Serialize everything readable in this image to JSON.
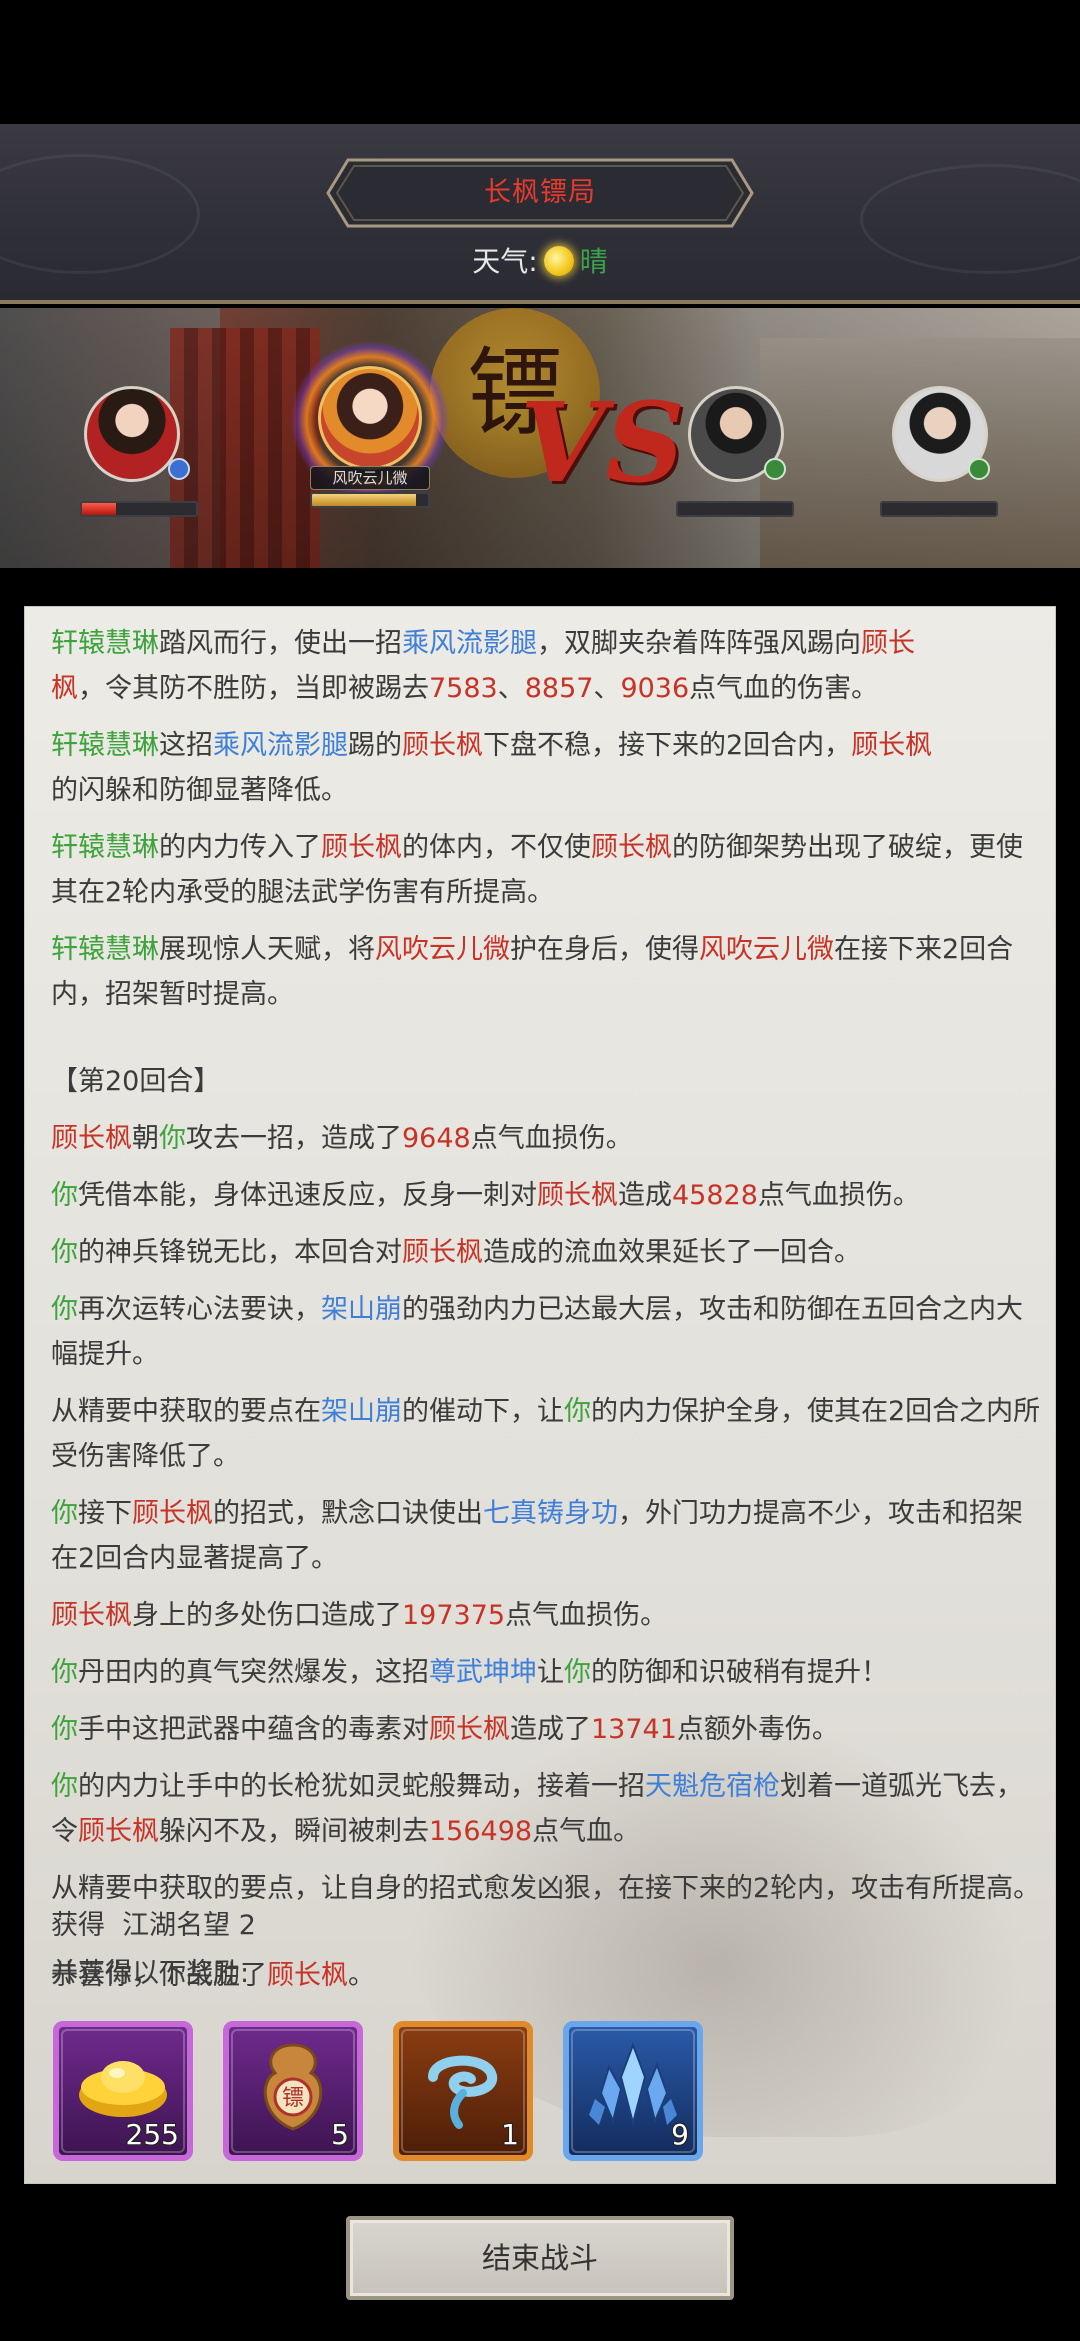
{
  "header": {
    "title": "长枫镖局",
    "weather_label": "天气:",
    "weather_value": "晴"
  },
  "battle": {
    "emblem_char": "镖",
    "vs_text": "VS",
    "allies": [
      {
        "name": "",
        "hp_fraction": 0.3
      },
      {
        "name": "风吹云儿微",
        "hp_fraction": 0.9
      }
    ],
    "enemies": [
      {
        "hp_fraction": 0.0
      },
      {
        "hp_fraction": 0.0
      }
    ]
  },
  "log": {
    "l1": {
      "a": "轩辕慧琳",
      "b": "踏风而行，使出一招",
      "c": "乘风流影腿",
      "d": "，双脚夹杂着阵阵强风踢向",
      "e": "顾长",
      "f": "枫",
      "g": "，令其防不胜防，当即被踢去",
      "h": "7583",
      "i": "、",
      "j": "8857",
      "k": "、",
      "l": "9036",
      "m": "点气血的伤害。"
    },
    "l2": {
      "a": "轩辕慧琳",
      "b": "这招",
      "c": "乘风流影腿",
      "d": "踢的",
      "e": "顾长枫",
      "f": "下盘不稳，接下来的2回合内，",
      "g": "顾长枫",
      "h": "的闪躲和防御显著降低。"
    },
    "l3": {
      "a": "轩辕慧琳",
      "b": "的内力传入了",
      "c": "顾长枫",
      "d": "的体内，不仅使",
      "e": "顾长枫",
      "f": "的防御架势出现了破绽，更使其在2轮内承受的腿法武学伤害有所提高。"
    },
    "l4": {
      "a": "轩辕慧琳",
      "b": "展现惊人天赋，将",
      "c": "风吹云儿微",
      "d": "护在身后，使得",
      "e": "风吹云儿微",
      "f": "在接下来2回合内，招架暂时提高。"
    },
    "round": "【第20回合】",
    "r1": {
      "a": "顾长枫",
      "b": "朝",
      "c": "你",
      "d": "攻去一招，造成了",
      "e": "9648",
      "f": "点气血损伤。"
    },
    "r2": {
      "a": "你",
      "b": "凭借本能，身体迅速反应，反身一刺对",
      "c": "顾长枫",
      "d": "造成",
      "e": "45828",
      "f": "点气血损伤。"
    },
    "r3": {
      "a": "你",
      "b": "的神兵锋锐无比，本回合对",
      "c": "顾长枫",
      "d": "造成的流血效果延长了一回合。"
    },
    "r4": {
      "a": "你",
      "b": "再次运转心法要诀，",
      "c": "架山崩",
      "d": "的强劲内力已达最大层，攻击和防御在五回合之内大幅提升。"
    },
    "r5": {
      "a": "从精要中获取的要点在",
      "b": "架山崩",
      "c": "的催动下，让",
      "d": "你",
      "e": "的内力保护全身，使其在2回合之内所受伤害降低了。"
    },
    "r6": {
      "a": "你",
      "b": "接下",
      "c": "顾长枫",
      "d": "的招式，默念口诀使出",
      "e": "七真铸身功",
      "f": "，外门功力提高不少，攻击和招架在2回合内显著提高了。"
    },
    "r7": {
      "a": "顾长枫",
      "b": "身上的多处伤口造成了",
      "c": "197375",
      "d": "点气血损伤。"
    },
    "r8": {
      "a": "你",
      "b": "丹田内的真气突然爆发，这招",
      "c": "尊武坤坤",
      "d": "让",
      "e": "你",
      "f": "的防御和识破稍有提升！"
    },
    "r9": {
      "a": "你",
      "b": "手中这把武器中蕴含的毒素对",
      "c": "顾长枫",
      "d": "造成了",
      "e": "13741",
      "f": "点额外毒伤。"
    },
    "r10": {
      "a": "你",
      "b": "的内力让手中的长枪犹如灵蛇般舞动，接着一招",
      "c": "天魁危宿枪",
      "d": "划着一道弧光飞去，令",
      "e": "顾长枫",
      "f": "躲闪不及，瞬间被刺去",
      "g": "156498",
      "h": "点气血。"
    },
    "r11": "从精要中获取的要点，让自身的招式愈发凶狠，在接下来的2轮内，攻击有所提高。",
    "win": {
      "a": "恭喜你，你战胜了",
      "b": "顾长枫",
      "c": "。"
    }
  },
  "rewards": {
    "gain_label": "获得",
    "fame_text": "江湖名望 2",
    "extra_label": "并获得以下奖励:",
    "items": [
      {
        "icon": "gold-ingot-icon",
        "count": "255",
        "rarity": "purple"
      },
      {
        "icon": "escort-token-icon",
        "count": "5",
        "rarity": "purple"
      },
      {
        "icon": "blue-swirl-icon",
        "count": "1",
        "rarity": "orange"
      },
      {
        "icon": "blue-crystal-icon",
        "count": "9",
        "rarity": "blue"
      }
    ]
  },
  "footer": {
    "end_button": "结束战斗"
  },
  "colors": {
    "skill": "#3f7fd8",
    "ally": "#3ea33d",
    "enemy": "#c73326",
    "title": "#e53b2c"
  }
}
